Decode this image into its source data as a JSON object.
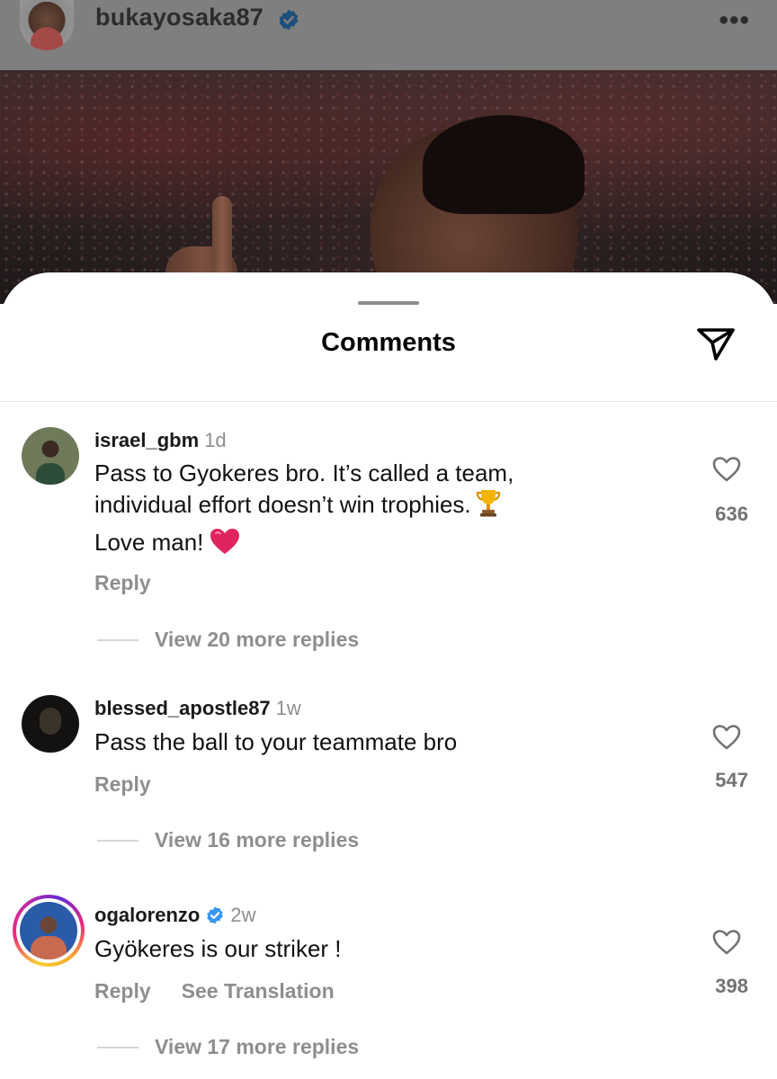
{
  "post": {
    "username": "bukayosaka87",
    "more_icon": "more-horizontal-icon",
    "more_glyph": "•••"
  },
  "sheet": {
    "title": "Comments",
    "share_icon": "send-icon"
  },
  "colors": {
    "verified": "#3897f0",
    "secondary_text": "#8e8e8e",
    "primary_text": "#111111",
    "heart_emoji": "#e0245e"
  },
  "comments": [
    {
      "username": "israel_gbm",
      "time": "1d",
      "text_lines": [
        "Pass to Gyokeres bro. It’s called a team,",
        "individual effort doesn’t win trophies.",
        "Love man!"
      ],
      "emojis": [
        "trophy",
        "red-heart"
      ],
      "actions": [
        "Reply"
      ],
      "likes": "636",
      "view_replies": "View 20 more replies"
    },
    {
      "username": "blessed_apostle87",
      "time": "1w",
      "text_lines": [
        "Pass the ball to your teammate bro"
      ],
      "actions": [
        "Reply"
      ],
      "likes": "547",
      "view_replies": "View 16 more replies"
    },
    {
      "username": "ogalorenzo",
      "verified": true,
      "time": "2w",
      "text_lines": [
        "Gyökeres is our striker !"
      ],
      "actions": [
        "Reply",
        "See Translation"
      ],
      "likes": "398",
      "view_replies": "View 17 more replies"
    }
  ]
}
